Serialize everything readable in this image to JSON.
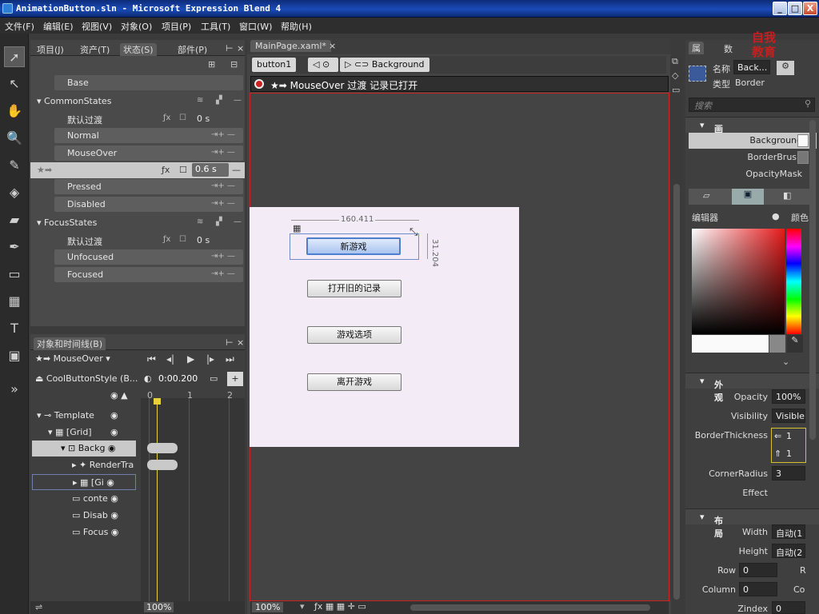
{
  "window": {
    "title": "AnimationButton.sln - Microsoft Expression Blend 4",
    "min": "_",
    "max": "□",
    "close": "X"
  },
  "menu": [
    "文件(F)",
    "编辑(E)",
    "视图(V)",
    "对象(O)",
    "项目(P)",
    "工具(T)",
    "窗口(W)",
    "帮助(H)"
  ],
  "states_panel": {
    "tabs": [
      "项目(J)",
      "资产(T)",
      "状态(S)",
      "部件(P)"
    ],
    "base": "Base",
    "groups": [
      {
        "name": "CommonStates",
        "default_transition": "默认过渡",
        "duration": "0 s",
        "states": [
          "Normal",
          "MouseOver",
          "Pressed",
          "Disabled"
        ],
        "selected_duration": "0.6 s"
      },
      {
        "name": "FocusStates",
        "default_transition": "默认过渡",
        "duration": "0 s",
        "states": [
          "Unfocused",
          "Focused"
        ]
      }
    ]
  },
  "objects_panel": {
    "title": "对象和时间线(B)",
    "storyboard": "MouseOver",
    "style": "CoolButtonStyle (B...",
    "time": "0:00.200",
    "ruler": [
      "0",
      "1",
      "2"
    ],
    "tree": [
      "Template",
      "[Grid]",
      "Backg",
      "RenderTra",
      "[Gi",
      "conte",
      "Disab",
      "Focus"
    ],
    "zoom": "100%"
  },
  "document": {
    "tab": "MainPage.xaml*",
    "breadcrumb": [
      "button1",
      "Background"
    ],
    "record_status": "MouseOver 过渡 记录已打开",
    "width_label": "160.411",
    "height_label": "31.204",
    "buttons": [
      "新游戏",
      "打开旧的记录",
      "游戏选项",
      "离开游戏"
    ],
    "zoom": "100%"
  },
  "properties": {
    "tabs": [
      "属",
      "数"
    ],
    "name_label": "名称",
    "name_value": "Back...",
    "type_label": "类型",
    "type_value": "Border",
    "search_placeholder": "搜索",
    "brush_section": "画笔",
    "brushes": [
      "Background",
      "BorderBrush",
      "OpacityMask"
    ],
    "editor_label": "编辑器",
    "color_label": "颜色",
    "appearance_section": "外观",
    "appearance": [
      {
        "label": "Opacity",
        "value": "100%"
      },
      {
        "label": "Visibility",
        "value": "Visible"
      },
      {
        "label": "BorderThickness",
        "value": "1",
        "value2": "1"
      },
      {
        "label": "CornerRadius",
        "value": "3"
      },
      {
        "label": "Effect",
        "value": ""
      }
    ],
    "layout_section": "布局",
    "layout": [
      {
        "label": "Width",
        "value": "自动(1"
      },
      {
        "label": "Height",
        "value": "自动(2"
      },
      {
        "label": "Row",
        "value": "0"
      },
      {
        "label": "Column",
        "value": "0"
      },
      {
        "label": "Zindex",
        "value": "0"
      }
    ],
    "layout_right": [
      "R",
      "Co"
    ]
  },
  "logo": "自我教育",
  "colors": {
    "accent": "#4d7fd0",
    "record": "#c22222"
  }
}
